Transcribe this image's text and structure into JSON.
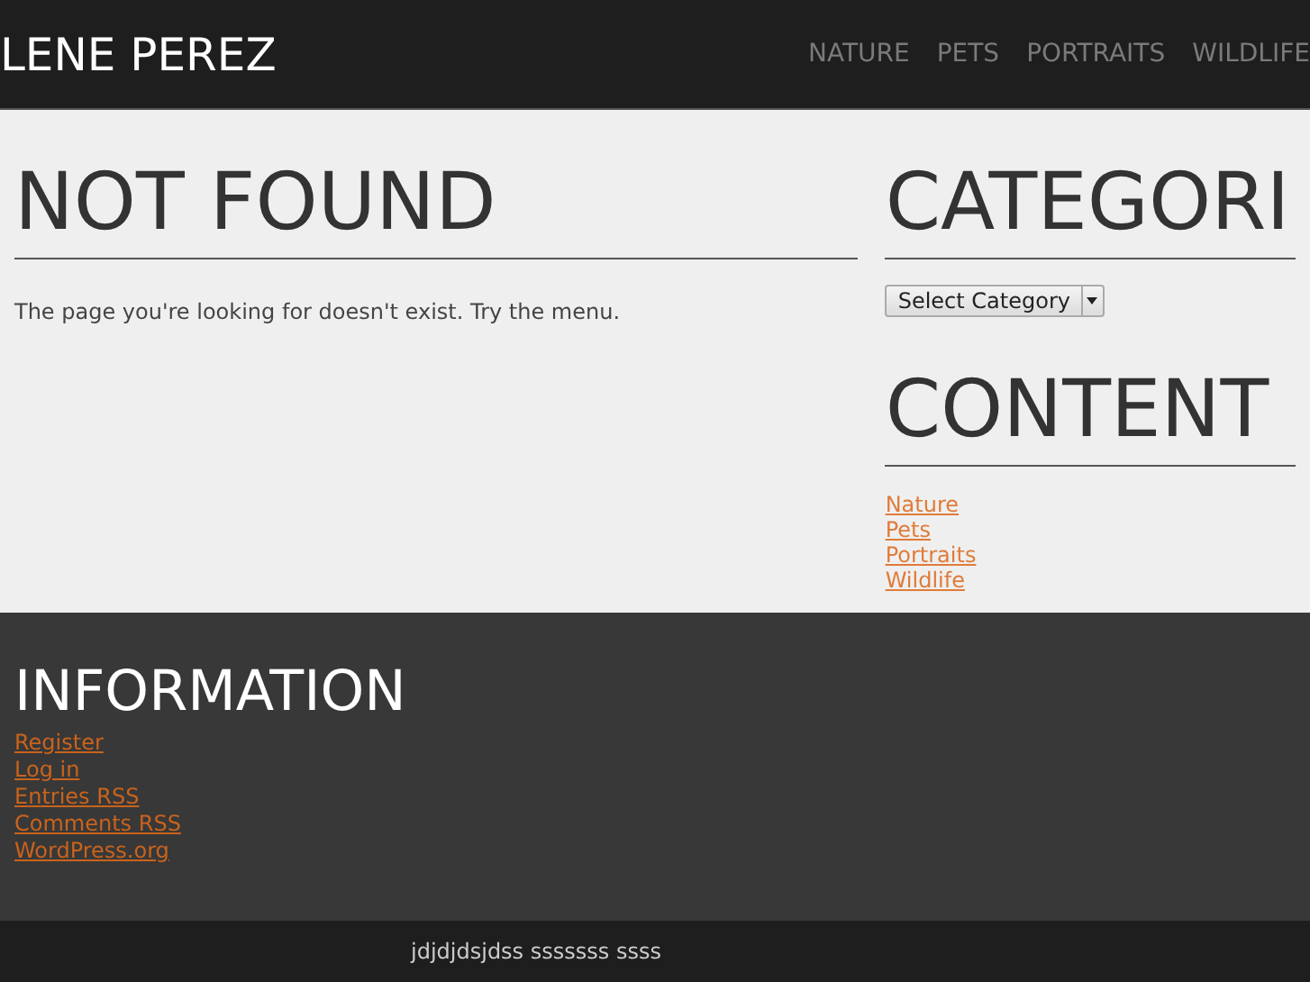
{
  "header": {
    "site_title": "LENE PEREZ",
    "nav": [
      {
        "label": "NATURE"
      },
      {
        "label": "PETS"
      },
      {
        "label": "PORTRAITS"
      },
      {
        "label": "WILDLIFE"
      }
    ]
  },
  "main": {
    "heading": "NOT FOUND",
    "message": "The page you're looking for doesn't exist. Try the menu."
  },
  "sidebar": {
    "categories_heading": "CATEGORI",
    "category_select": {
      "value": "Select Category"
    },
    "content_heading": "CONTENT",
    "content_links": [
      "Nature",
      "Pets",
      "Portraits",
      "Wildlife"
    ]
  },
  "footer_widget": {
    "heading": "INFORMATION",
    "links": [
      "Register",
      "Log in",
      "Entries RSS",
      "Comments RSS",
      "WordPress.org"
    ]
  },
  "bottom_bar": {
    "text": "jdjdjdsjdss sssssss ssss"
  }
}
